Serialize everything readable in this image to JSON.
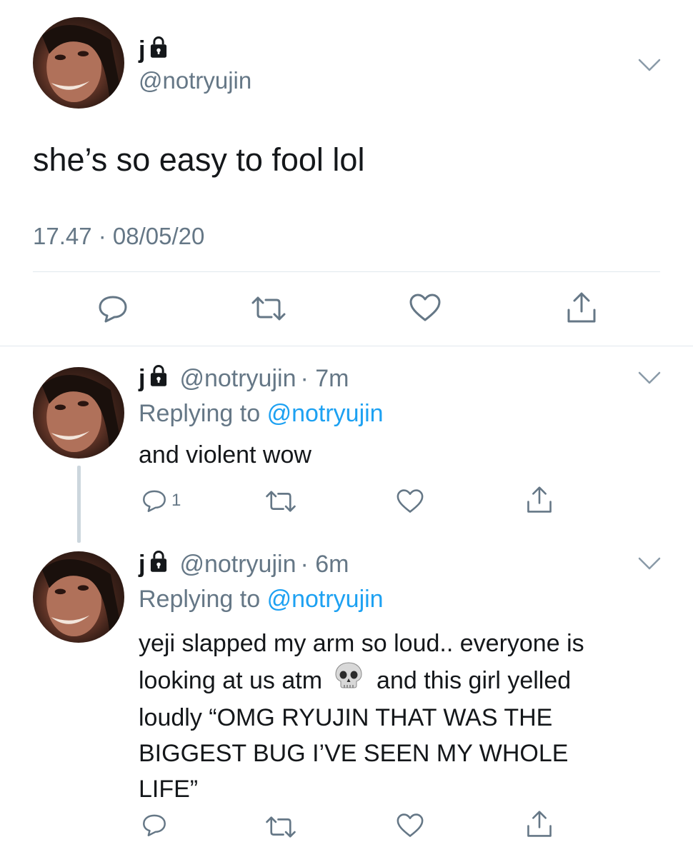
{
  "main_tweet": {
    "display_name": "j",
    "handle": "@notryujin",
    "text": "she’s so easy to fool lol",
    "timestamp": "17.47 · 08/05/20"
  },
  "replies": [
    {
      "display_name": "j",
      "handle": "@notryujin",
      "time": "· 7m",
      "replying_prefix": "Replying to",
      "replying_to": "@notryujin",
      "text_lines": [
        "and violent wow"
      ],
      "reply_count": "1"
    },
    {
      "display_name": "j",
      "handle": "@notryujin",
      "time": "· 6m",
      "replying_prefix": "Replying to",
      "replying_to": "@notryujin",
      "text_lines": [
        "yeji slapped my arm so loud.. everyone is",
        "looking at us atm",
        "and this girl yelled",
        "loudly “OMG RYUJIN THAT WAS THE",
        "BIGGEST BUG I’VE SEEN MY WHOLE",
        "LIFE”"
      ],
      "reply_count": ""
    }
  ],
  "colors": {
    "text": "#14171a",
    "secondary": "#657786",
    "link": "#1da1f2",
    "divider": "#e1e8ed",
    "thread_line": "#ccd6dd"
  },
  "icons": [
    "lock-icon",
    "chevron-down-icon",
    "reply-icon",
    "retweet-icon",
    "like-icon",
    "share-icon",
    "skull-emoji"
  ]
}
